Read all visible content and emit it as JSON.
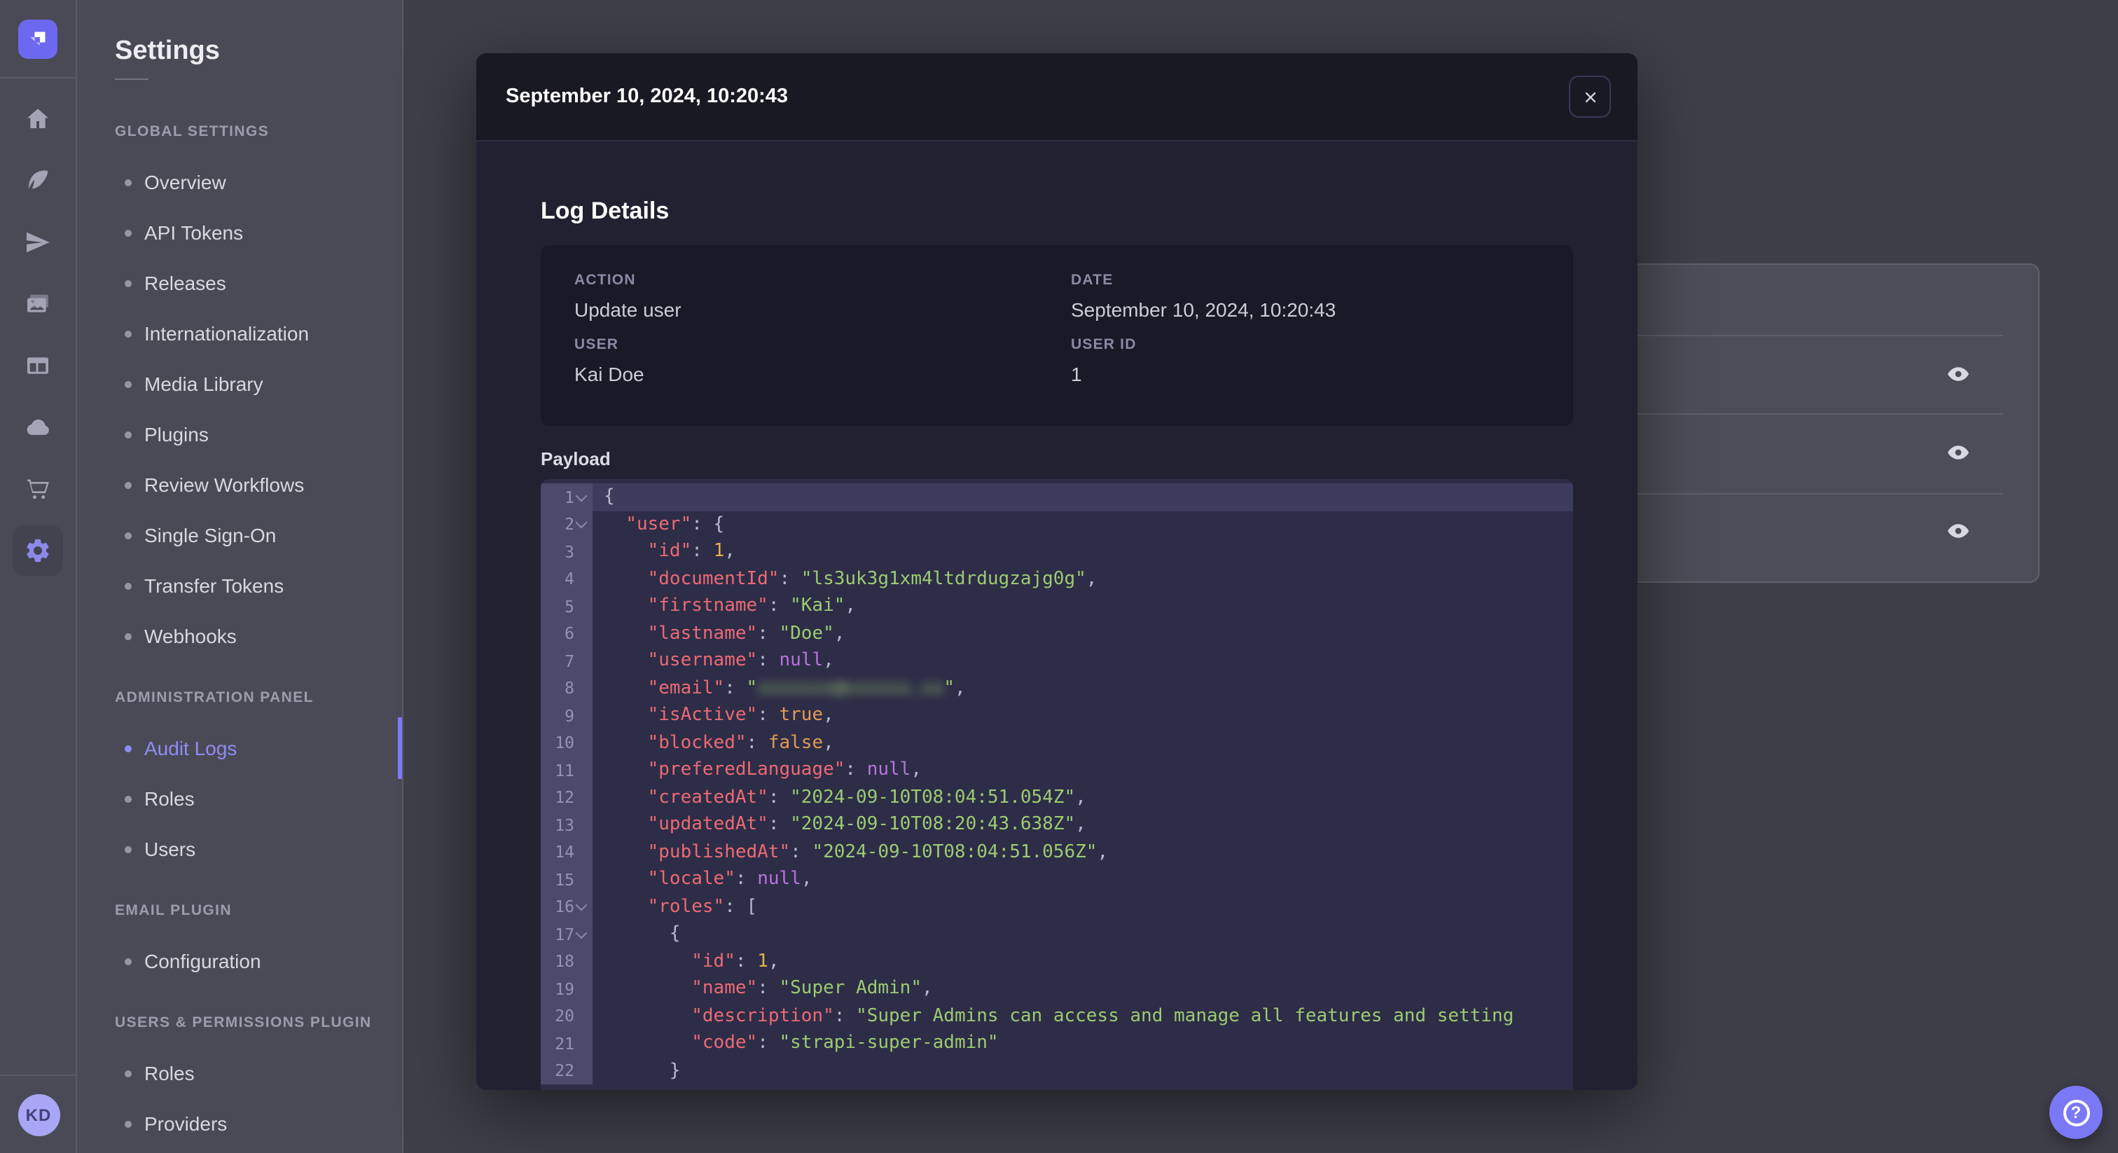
{
  "colors": {
    "accent": "#7b79ff",
    "modal_header_bg": "#181826",
    "modal_body_bg": "#212132",
    "code_key": "#ec6a75",
    "code_string": "#9ccb72",
    "code_number": "#e5b04a",
    "code_boolean": "#e09a55",
    "code_null": "#b874dd"
  },
  "rail": {
    "logo_icon": "strapi-logo",
    "icons": [
      "home",
      "feather",
      "paper-plane",
      "media-library",
      "layout",
      "cloud",
      "cart",
      "settings-gear"
    ],
    "active_icon": "settings-gear",
    "avatar": "KD"
  },
  "sidebar": {
    "title": "Settings",
    "sections": [
      {
        "label": "GLOBAL SETTINGS",
        "items": [
          {
            "label": "Overview"
          },
          {
            "label": "API Tokens"
          },
          {
            "label": "Releases"
          },
          {
            "label": "Internationalization"
          },
          {
            "label": "Media Library"
          },
          {
            "label": "Plugins"
          },
          {
            "label": "Review Workflows"
          },
          {
            "label": "Single Sign-On"
          },
          {
            "label": "Transfer Tokens"
          },
          {
            "label": "Webhooks"
          }
        ]
      },
      {
        "label": "ADMINISTRATION PANEL",
        "items": [
          {
            "label": "Audit Logs",
            "active": true
          },
          {
            "label": "Roles"
          },
          {
            "label": "Users"
          }
        ]
      },
      {
        "label": "EMAIL PLUGIN",
        "items": [
          {
            "label": "Configuration"
          }
        ]
      },
      {
        "label": "USERS & PERMISSIONS PLUGIN",
        "items": [
          {
            "label": "Roles"
          },
          {
            "label": "Providers"
          }
        ]
      }
    ]
  },
  "background_table": {
    "row_count": 3,
    "row_action_icon": "eye"
  },
  "modal": {
    "title": "September 10, 2024, 10:20:43",
    "close_icon": "close",
    "heading": "Log Details",
    "details": [
      {
        "label": "ACTION",
        "value": "Update user"
      },
      {
        "label": "DATE",
        "value": "September 10, 2024, 10:20:43"
      },
      {
        "label": "USER",
        "value": "Kai Doe"
      },
      {
        "label": "USER ID",
        "value": "1"
      }
    ],
    "payload_label": "Payload",
    "code": {
      "lines": [
        {
          "n": 1,
          "fold": true,
          "tokens": [
            [
              "p",
              "{"
            ]
          ]
        },
        {
          "n": 2,
          "fold": true,
          "tokens": [
            [
              "p",
              "  "
            ],
            [
              "k",
              "\"user\""
            ],
            [
              "p",
              ": {"
            ]
          ]
        },
        {
          "n": 3,
          "fold": false,
          "tokens": [
            [
              "p",
              "    "
            ],
            [
              "k",
              "\"id\""
            ],
            [
              "p",
              ": "
            ],
            [
              "n",
              "1"
            ],
            [
              "p",
              ","
            ]
          ]
        },
        {
          "n": 4,
          "fold": false,
          "tokens": [
            [
              "p",
              "    "
            ],
            [
              "k",
              "\"documentId\""
            ],
            [
              "p",
              ": "
            ],
            [
              "s",
              "\"ls3uk3g1xm4ltdrdugzajg0g\""
            ],
            [
              "p",
              ","
            ]
          ]
        },
        {
          "n": 5,
          "fold": false,
          "tokens": [
            [
              "p",
              "    "
            ],
            [
              "k",
              "\"firstname\""
            ],
            [
              "p",
              ": "
            ],
            [
              "s",
              "\"Kai\""
            ],
            [
              "p",
              ","
            ]
          ]
        },
        {
          "n": 6,
          "fold": false,
          "tokens": [
            [
              "p",
              "    "
            ],
            [
              "k",
              "\"lastname\""
            ],
            [
              "p",
              ": "
            ],
            [
              "s",
              "\"Doe\""
            ],
            [
              "p",
              ","
            ]
          ]
        },
        {
          "n": 7,
          "fold": false,
          "tokens": [
            [
              "p",
              "    "
            ],
            [
              "k",
              "\"username\""
            ],
            [
              "p",
              ": "
            ],
            [
              "u",
              "null"
            ],
            [
              "p",
              ","
            ]
          ]
        },
        {
          "n": 8,
          "fold": false,
          "tokens": [
            [
              "p",
              "    "
            ],
            [
              "k",
              "\"email\""
            ],
            [
              "p",
              ": "
            ],
            [
              "s",
              "\""
            ],
            [
              "r",
              "xxxxxxx@xxxxxx.xx"
            ],
            [
              "s",
              "\""
            ],
            [
              "p",
              ","
            ]
          ]
        },
        {
          "n": 9,
          "fold": false,
          "tokens": [
            [
              "p",
              "    "
            ],
            [
              "k",
              "\"isActive\""
            ],
            [
              "p",
              ": "
            ],
            [
              "b",
              "true"
            ],
            [
              "p",
              ","
            ]
          ]
        },
        {
          "n": 10,
          "fold": false,
          "tokens": [
            [
              "p",
              "    "
            ],
            [
              "k",
              "\"blocked\""
            ],
            [
              "p",
              ": "
            ],
            [
              "b",
              "false"
            ],
            [
              "p",
              ","
            ]
          ]
        },
        {
          "n": 11,
          "fold": false,
          "tokens": [
            [
              "p",
              "    "
            ],
            [
              "k",
              "\"preferedLanguage\""
            ],
            [
              "p",
              ": "
            ],
            [
              "u",
              "null"
            ],
            [
              "p",
              ","
            ]
          ]
        },
        {
          "n": 12,
          "fold": false,
          "tokens": [
            [
              "p",
              "    "
            ],
            [
              "k",
              "\"createdAt\""
            ],
            [
              "p",
              ": "
            ],
            [
              "s",
              "\"2024-09-10T08:04:51.054Z\""
            ],
            [
              "p",
              ","
            ]
          ]
        },
        {
          "n": 13,
          "fold": false,
          "tokens": [
            [
              "p",
              "    "
            ],
            [
              "k",
              "\"updatedAt\""
            ],
            [
              "p",
              ": "
            ],
            [
              "s",
              "\"2024-09-10T08:20:43.638Z\""
            ],
            [
              "p",
              ","
            ]
          ]
        },
        {
          "n": 14,
          "fold": false,
          "tokens": [
            [
              "p",
              "    "
            ],
            [
              "k",
              "\"publishedAt\""
            ],
            [
              "p",
              ": "
            ],
            [
              "s",
              "\"2024-09-10T08:04:51.056Z\""
            ],
            [
              "p",
              ","
            ]
          ]
        },
        {
          "n": 15,
          "fold": false,
          "tokens": [
            [
              "p",
              "    "
            ],
            [
              "k",
              "\"locale\""
            ],
            [
              "p",
              ": "
            ],
            [
              "u",
              "null"
            ],
            [
              "p",
              ","
            ]
          ]
        },
        {
          "n": 16,
          "fold": true,
          "tokens": [
            [
              "p",
              "    "
            ],
            [
              "k",
              "\"roles\""
            ],
            [
              "p",
              ": ["
            ]
          ]
        },
        {
          "n": 17,
          "fold": true,
          "tokens": [
            [
              "p",
              "      {"
            ]
          ]
        },
        {
          "n": 18,
          "fold": false,
          "tokens": [
            [
              "p",
              "        "
            ],
            [
              "k",
              "\"id\""
            ],
            [
              "p",
              ": "
            ],
            [
              "n",
              "1"
            ],
            [
              "p",
              ","
            ]
          ]
        },
        {
          "n": 19,
          "fold": false,
          "tokens": [
            [
              "p",
              "        "
            ],
            [
              "k",
              "\"name\""
            ],
            [
              "p",
              ": "
            ],
            [
              "s",
              "\"Super Admin\""
            ],
            [
              "p",
              ","
            ]
          ]
        },
        {
          "n": 20,
          "fold": false,
          "tokens": [
            [
              "p",
              "        "
            ],
            [
              "k",
              "\"description\""
            ],
            [
              "p",
              ": "
            ],
            [
              "s",
              "\"Super Admins can access and manage all features and setting"
            ]
          ]
        },
        {
          "n": 21,
          "fold": false,
          "tokens": [
            [
              "p",
              "        "
            ],
            [
              "k",
              "\"code\""
            ],
            [
              "p",
              ": "
            ],
            [
              "s",
              "\"strapi-super-admin\""
            ]
          ]
        },
        {
          "n": 22,
          "fold": false,
          "tokens": [
            [
              "p",
              "      }"
            ]
          ]
        }
      ]
    }
  },
  "help": {
    "icon": "question-mark"
  }
}
